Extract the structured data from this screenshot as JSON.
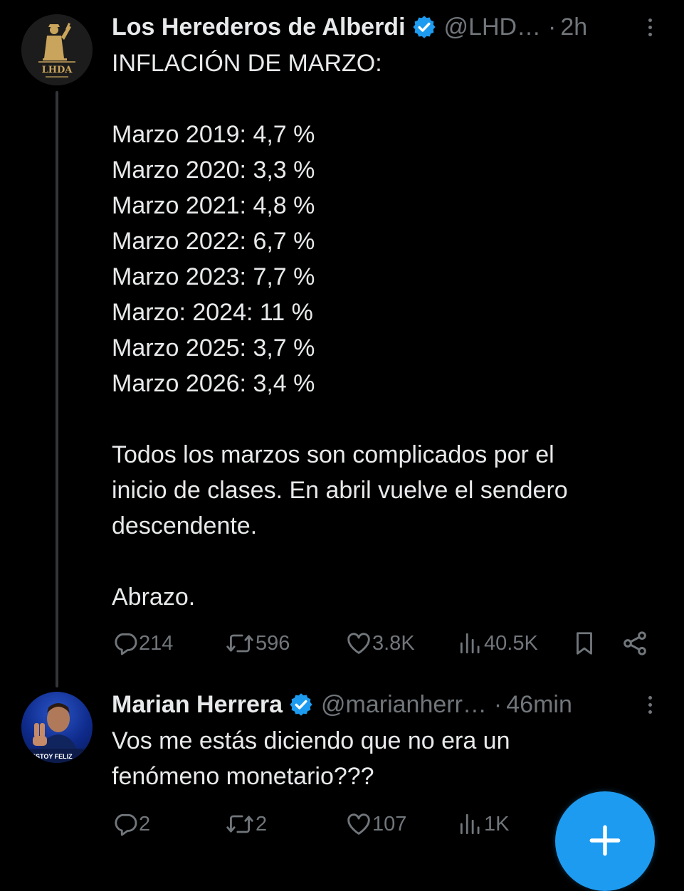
{
  "tweet1": {
    "author_name": "Los Herederos de Alberdi",
    "handle": "@LHD…",
    "separator": "·",
    "time": "2h",
    "avatar_text": "LHDA",
    "text": "INFLACIÓN DE MARZO:\n\nMarzo 2019: 4,7 %\nMarzo 2020: 3,3 %\nMarzo 2021: 4,8 %\nMarzo 2022: 6,7 %\nMarzo 2023: 7,7 %\nMarzo: 2024: 11 %\nMarzo 2025: 3,7 %\nMarzo 2026: 3,4 %\n\nTodos los marzos son complicados por el\ninicio de clases. En abril vuelve el sendero\ndescendente.\n\nAbrazo.",
    "replies": "214",
    "reposts": "596",
    "likes": "3.8K",
    "views": "40.5K"
  },
  "tweet2": {
    "author_name": "Marian Herrera",
    "handle": "@marianherr…",
    "separator": "·",
    "time": "46min",
    "avatar_caption": "ESTOY FELIZ",
    "text": "Vos me estás diciendo que no era un\nfenómeno monetario???",
    "replies": "2",
    "reposts": "2",
    "likes": "107",
    "views": "1K"
  },
  "colors": {
    "background": "#000000",
    "text": "#e7e9ea",
    "muted": "#71767b",
    "accent": "#1d9bf0",
    "thread_line": "#333639",
    "avatar_gold": "#c9a45c"
  },
  "icons": {
    "verified": "verified-badge-icon",
    "reply": "reply-icon",
    "repost": "repost-icon",
    "like": "heart-icon",
    "views": "views-chart-icon",
    "bookmark": "bookmark-icon",
    "share": "share-icon",
    "more": "more-vertical-icon",
    "compose": "plus-icon"
  }
}
